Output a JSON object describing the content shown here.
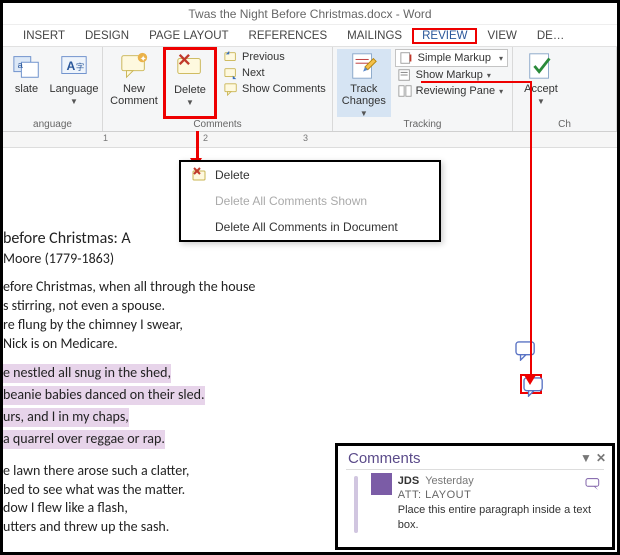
{
  "window": {
    "title": "Twas the Night Before Christmas.docx - Word"
  },
  "tabs": {
    "items": [
      "INSERT",
      "DESIGN",
      "PAGE LAYOUT",
      "REFERENCES",
      "MAILINGS",
      "REVIEW",
      "VIEW",
      "DE…"
    ],
    "active_index": 5
  },
  "ribbon": {
    "language": {
      "translate": "slate",
      "language": "Language",
      "group_label": "anguage"
    },
    "comments": {
      "new_comment": "New Comment",
      "delete": "Delete",
      "previous": "Previous",
      "next": "Next",
      "show_comments": "Show Comments",
      "group_label": "Comments"
    },
    "tracking": {
      "track_changes": "Track Changes",
      "simple_markup": "Simple Markup",
      "show_markup": "Show Markup",
      "reviewing_pane": "Reviewing Pane",
      "group_label": "Tracking"
    },
    "changes": {
      "accept": "Accept",
      "group_label": "Ch"
    }
  },
  "delete_menu": {
    "delete": "Delete",
    "delete_shown": "Delete All Comments Shown",
    "delete_doc": "Delete All Comments in Document"
  },
  "document": {
    "title_line": "before Christmas: A",
    "byline": "Moore (1779-1863)",
    "p1": [
      "efore Christmas, when all through the house",
      "s stirring, not even a spouse.",
      "re flung by the chimney I swear,",
      "Nick is on Medicare."
    ],
    "p2": [
      "e nestled all snug in the shed,",
      " beanie babies danced on their sled.",
      "urs, and I in my chaps,",
      "a quarrel over reggae or rap."
    ],
    "p3": [
      "e lawn there arose such a clatter,",
      " bed to see what was the matter.",
      "dow I flew like a flash,",
      "utters and threw up the sash."
    ]
  },
  "comments_panel": {
    "title": "Comments",
    "author": "JDS",
    "when": "Yesterday",
    "att": "ATT: LAYOUT",
    "body": "Place this entire paragraph inside a text box."
  }
}
